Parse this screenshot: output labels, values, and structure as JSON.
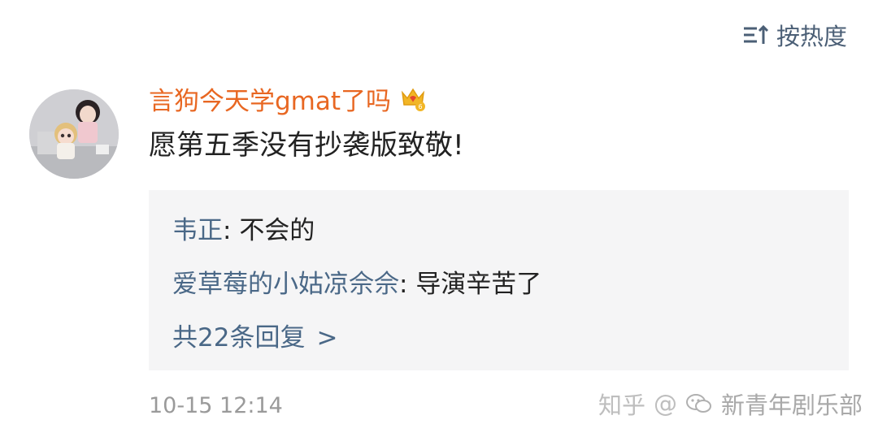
{
  "sort": {
    "label": "按热度",
    "icon": "sort-icon"
  },
  "comment": {
    "avatar_icon": "user-avatar",
    "username": "言狗今天学gmat了吗",
    "badge_icon": "vip-crown-badge-icon",
    "badge_level": "6",
    "text": "愿第五季没有抄袭版致敬!",
    "timestamp": "10-15 12:14"
  },
  "replies": {
    "items": [
      {
        "author": "韦正",
        "separator": ": ",
        "text": "不会的"
      },
      {
        "author": "爱草莓的小姑凉佘佘",
        "separator": ": ",
        "text": "导演辛苦了"
      }
    ],
    "more_label": "共22条回复",
    "more_chevron": ">"
  },
  "watermark": {
    "platform": "知乎",
    "at": "@",
    "account": "新青年剧乐部",
    "icon": "wechat-icon"
  },
  "colors": {
    "username": "#e86722",
    "reply_author": "#4a6887",
    "sort_text": "#4b5f76",
    "reply_bg": "#f5f5f6",
    "timestamp": "#9a9a9a"
  }
}
